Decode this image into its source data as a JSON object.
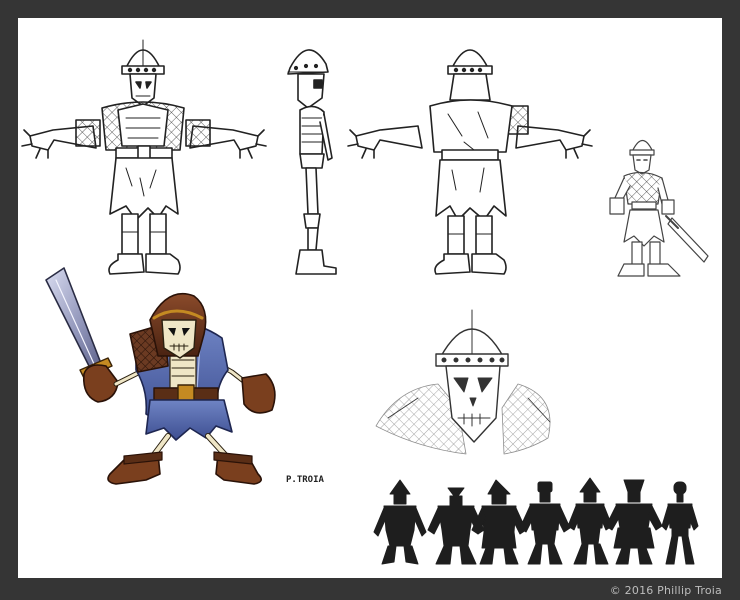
{
  "artwork": {
    "signature": "P.TROIA",
    "copyright": "© 2016 Phillip Troia"
  }
}
